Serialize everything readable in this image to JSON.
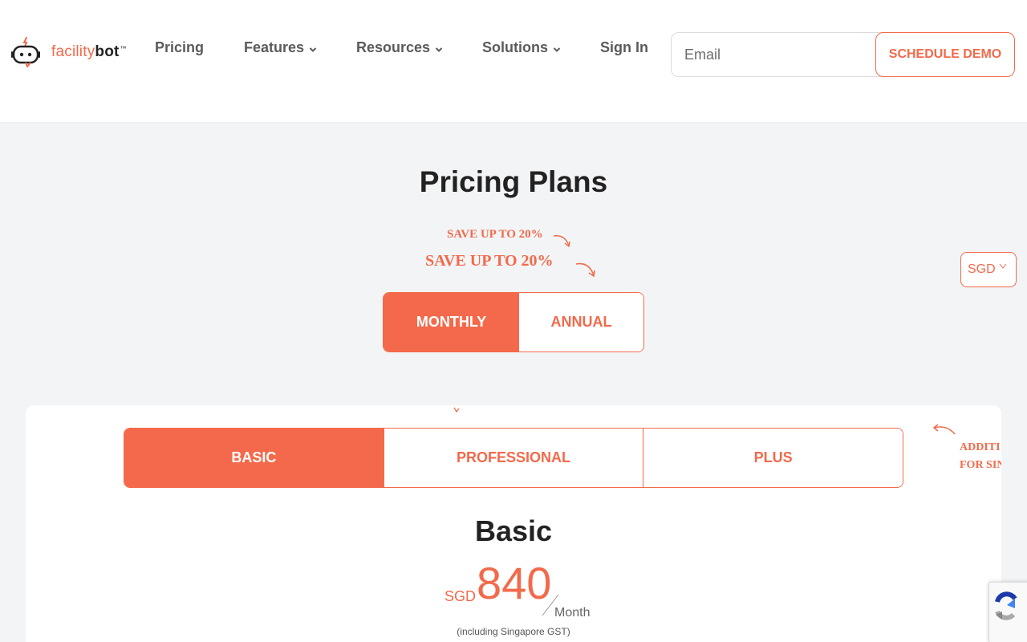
{
  "header": {
    "logo": {
      "text_a": "facility",
      "text_b": "bot",
      "tm": "™"
    },
    "nav": {
      "pricing": "Pricing",
      "features": "Features",
      "resources": "Resources",
      "solutions": "Solutions",
      "signin": "Sign In"
    },
    "email_placeholder": "Email",
    "demo_label": "SCHEDULE DEMO"
  },
  "hero": {
    "title": "Pricing Plans",
    "save_small": "SAVE UP TO 20%",
    "save_large": "SAVE UP TO 20%",
    "billing": {
      "monthly": "MONTHLY",
      "annual": "ANNUAL",
      "selected": "MONTHLY"
    },
    "currency": "SGD"
  },
  "plans": {
    "tabs": [
      "BASIC",
      "PROFESSIONAL",
      "PLUS"
    ],
    "selected": "BASIC",
    "side_note_line1": "ADDITI",
    "side_note_line2": "FOR SIN",
    "plan_name": "Basic",
    "currency": "SGD",
    "amount": "840",
    "period": "Month",
    "note": "(including Singapore GST)"
  },
  "colors": {
    "accent": "#f4694b",
    "text": "#222222",
    "background": "#f3f4f6"
  }
}
